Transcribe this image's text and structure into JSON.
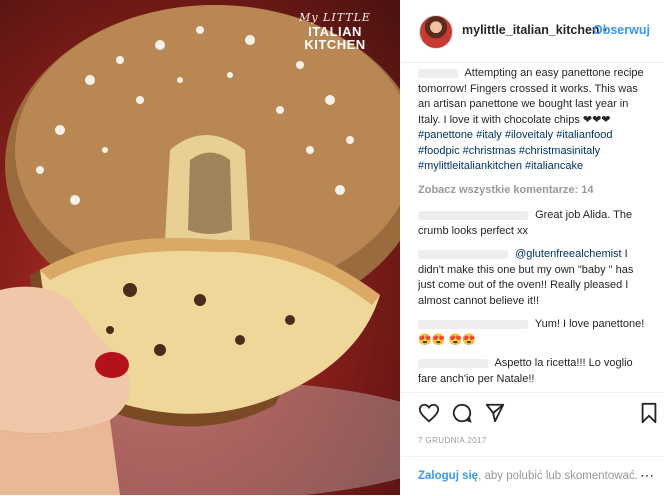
{
  "watermark": {
    "line1": "My LITTLE",
    "line2": "ITALIAN KITCHEN"
  },
  "header": {
    "username": "mylittle_italian_kitchen",
    "separator": "•",
    "follow": "Obserwuj"
  },
  "caption": {
    "text": "Attempting an easy panettone recipe tomorrow! Fingers crossed it works. This was an artisan panettone we bought last year in Italy. I love it with chocolate chips ❤❤❤",
    "hashtags": "#panettone #italy #iloveitaly #italianfood #foodpic #christmas #christmasinitaly #mylittleitaliankitchen #italiancake"
  },
  "view_all": "Zobacz wszystkie komentarze: 14",
  "comments": [
    {
      "text": "Great job Alida. The crumb looks perfect xx"
    },
    {
      "mention": "@glutenfreealchemist",
      "text": " I didn't make this one but my own \"baby \" has just come out of the oven!! Really pleased I almost cannot believe it!!"
    },
    {
      "text": "Yum! I love panettone! 😍😍 😍😍"
    },
    {
      "text": "Aspetto la ricetta!!! Lo voglio fare anch'io per Natale!!"
    }
  ],
  "actions": {
    "like": "heart-icon",
    "comment": "comment-icon",
    "share": "share-icon",
    "save": "bookmark-icon"
  },
  "date": "7 GRUDNIA 2017",
  "footer": {
    "login": "Zaloguj się",
    "rest": ", aby polubić lub skomentować.",
    "more": "⋯"
  }
}
